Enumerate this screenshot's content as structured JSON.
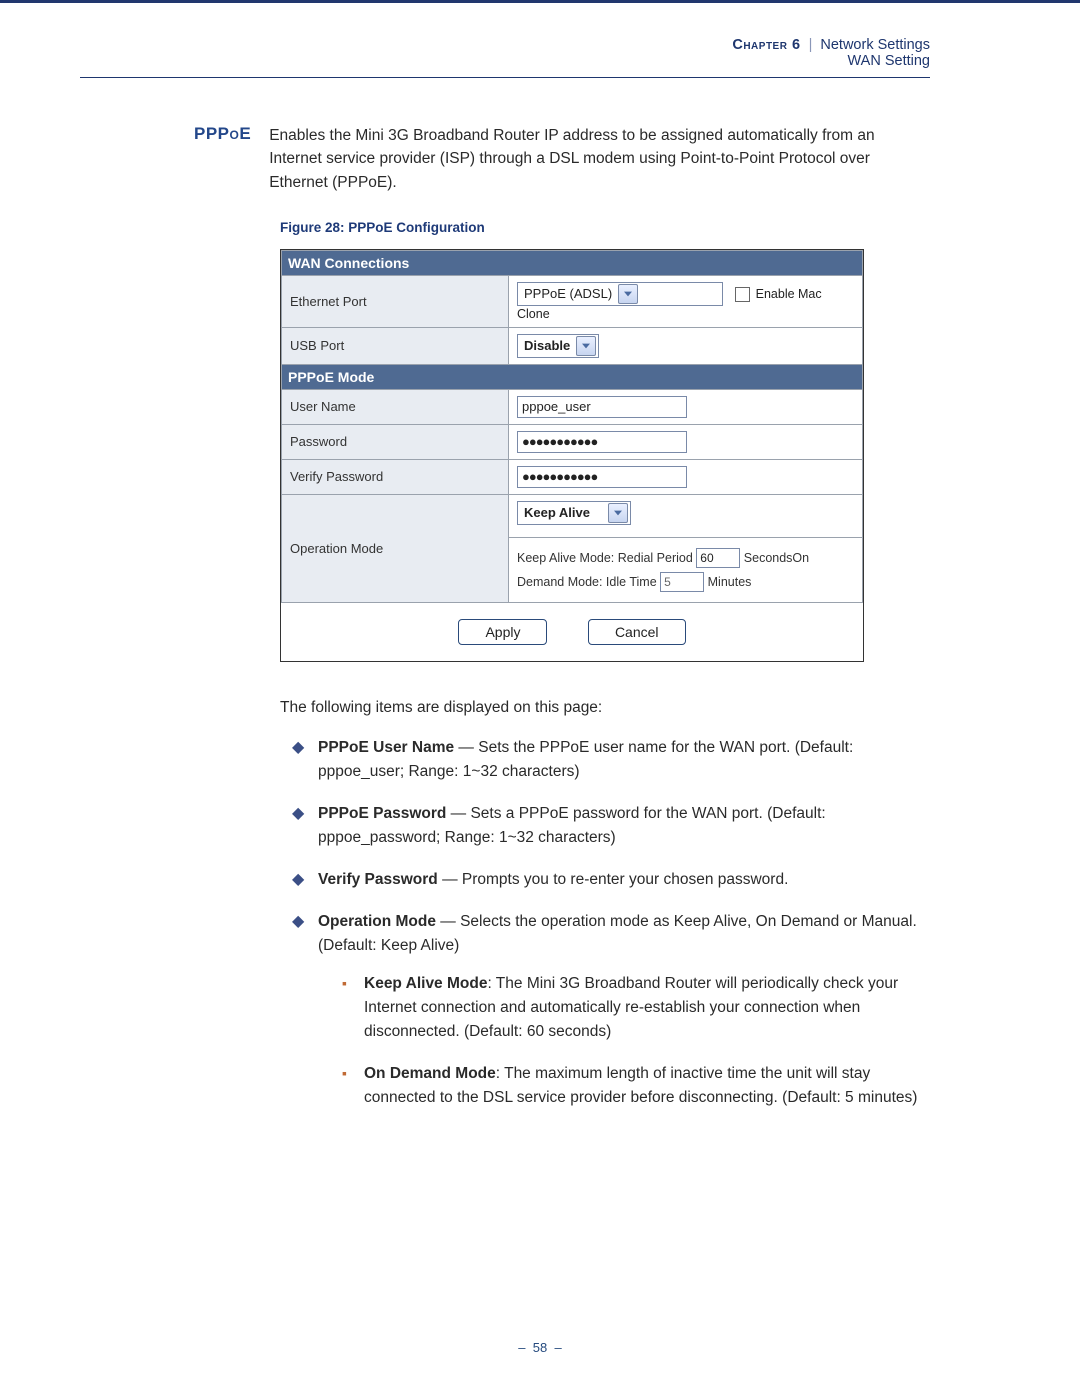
{
  "header": {
    "chapter": "Chapter 6",
    "section": "Network Settings",
    "subsection": "WAN Setting"
  },
  "page_number": "58",
  "section_title": "PPPoE",
  "intro": "Enables the Mini 3G Broadband Router IP address to be assigned automatically from an Internet service provider (ISP) through a DSL modem using Point-to-Point Protocol over Ethernet (PPPoE).",
  "figure_caption": "Figure 28:  PPPoE Configuration",
  "ui": {
    "wan_header": "WAN Connections",
    "ethernet_label": "Ethernet Port",
    "ethernet_select": "PPPoE (ADSL)",
    "enable_clone": "Enable Mac Clone",
    "usb_label": "USB Port",
    "usb_select": "Disable",
    "mode_header": "PPPoE Mode",
    "user_label": "User Name",
    "user_value": "pppoe_user",
    "pass_label": "Password",
    "pass_value": "●●●●●●●●●●●",
    "verify_label": "Verify Password",
    "verify_value": "●●●●●●●●●●●",
    "op_label": "Operation Mode",
    "op_select": "Keep Alive",
    "keepalive_line_a": "Keep Alive Mode: Redial Period",
    "keepalive_val": "60",
    "keepalive_unit": "SecondsOn",
    "demand_line_a": "Demand Mode: Idle Time",
    "demand_val": "5",
    "demand_unit": "Minutes",
    "apply": "Apply",
    "cancel": "Cancel"
  },
  "post": {
    "lead": "The following items are displayed on this page:",
    "items": [
      {
        "bold": "PPPoE User Name",
        "rest": " — Sets the PPPoE user name for the WAN port. (Default: pppoe_user; Range: 1~32 characters)"
      },
      {
        "bold": "PPPoE Password",
        "rest": " — Sets a PPPoE password for the WAN port. (Default: pppoe_password; Range: 1~32 characters)"
      },
      {
        "bold": "Verify Password",
        "rest": " — Prompts you to re-enter your chosen password."
      },
      {
        "bold": "Operation Mode",
        "rest": " — Selects the operation mode as Keep Alive, On Demand or Manual. (Default: Keep Alive)",
        "sub": [
          {
            "bold": "Keep Alive Mode",
            "rest": ": The Mini 3G Broadband Router will periodically check your Internet connection and automatically re-establish your connection when disconnected. (Default: 60 seconds)"
          },
          {
            "bold": "On Demand Mode",
            "rest": ": The maximum length of inactive time the unit will stay connected to the DSL service provider before disconnecting. (Default: 5 minutes)"
          }
        ]
      }
    ]
  }
}
